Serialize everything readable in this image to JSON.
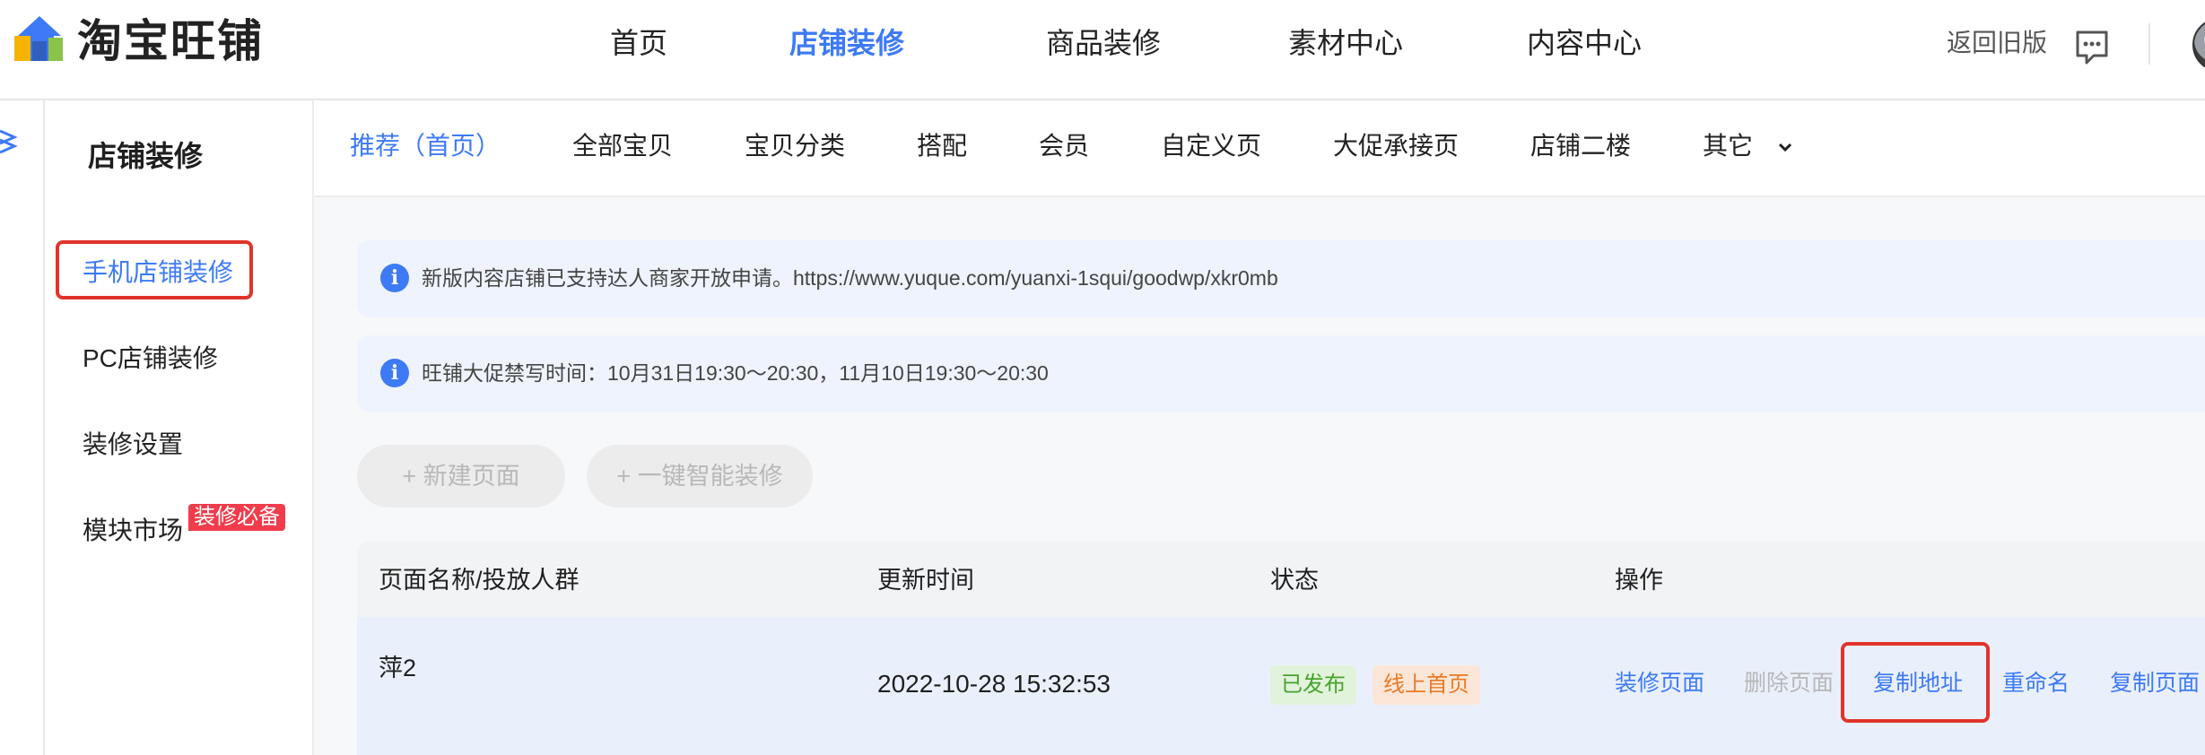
{
  "header": {
    "logo_text": "淘宝旺铺",
    "nav": [
      "首页",
      "店铺装修",
      "商品装修",
      "素材中心",
      "内容中心"
    ],
    "active_nav": "店铺装修",
    "back_old": "返回旧版"
  },
  "sidebar": {
    "title": "店铺装修",
    "items": [
      {
        "label": "手机店铺装修",
        "active": true
      },
      {
        "label": "PC店铺装修"
      },
      {
        "label": "装修设置"
      },
      {
        "label": "模块市场",
        "badge": "装修必备"
      }
    ]
  },
  "tabs": {
    "items": [
      "推荐（首页）",
      "全部宝贝",
      "宝贝分类",
      "搭配",
      "会员",
      "自定义页",
      "大促承接页",
      "店铺二楼",
      "其它"
    ],
    "active": "推荐（首页）"
  },
  "notices": [
    {
      "text": "新版内容店铺已支持达人商家开放申请。https://www.yuque.com/yuanxi-1squi/goodwp/xkr0mb"
    },
    {
      "text": "旺铺大促禁写时间：10月31日19:30～20:30，11月10日19:30～20:30"
    }
  ],
  "actions": {
    "new_page": "+ 新建页面",
    "smart_decor": "+ 一键智能装修"
  },
  "table": {
    "headers": [
      "页面名称/投放人群",
      "更新时间",
      "状态",
      "操作"
    ],
    "rows": [
      {
        "name": "萍2",
        "updated": "2022-10-28 15:32:53",
        "tags": [
          "已发布",
          "线上首页"
        ],
        "ops": [
          "装修页面",
          "删除页面",
          "复制地址",
          "重命名",
          "复制页面"
        ]
      }
    ]
  },
  "colors": {
    "accent": "#3d7af5",
    "highlight_box": "#e0342b",
    "badge": "#f03c4b"
  }
}
